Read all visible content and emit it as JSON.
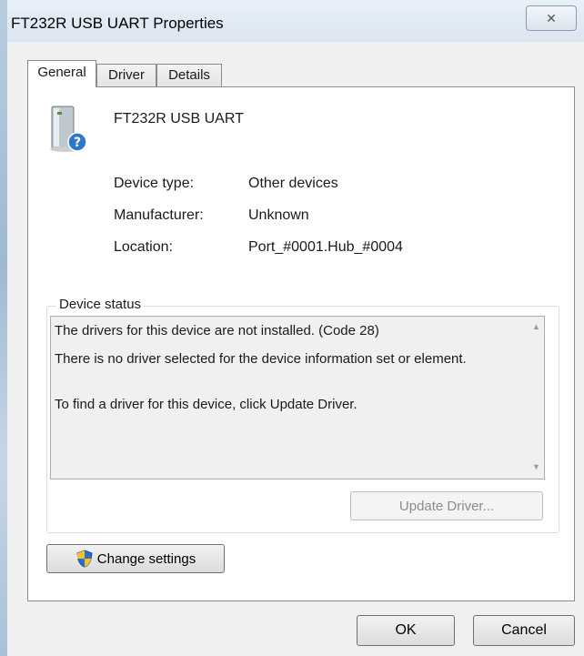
{
  "window": {
    "title": "FT232R USB UART Properties",
    "close_glyph": "✕"
  },
  "tabs": [
    {
      "label": "General",
      "active": true
    },
    {
      "label": "Driver",
      "active": false
    },
    {
      "label": "Details",
      "active": false
    }
  ],
  "device": {
    "name": "FT232R USB UART",
    "icon": "unknown-device-icon",
    "properties": [
      {
        "label": "Device type:",
        "value": "Other devices"
      },
      {
        "label": "Manufacturer:",
        "value": "Unknown"
      },
      {
        "label": "Location:",
        "value": "Port_#0001.Hub_#0004"
      }
    ]
  },
  "status": {
    "group_title": "Device status",
    "lines": [
      "The drivers for this device are not installed. (Code 28)",
      "There is no driver selected for the device information set or element.",
      "To find a driver for this device, click Update Driver."
    ]
  },
  "buttons": {
    "update_driver": "Update Driver...",
    "change_settings": "Change settings",
    "ok": "OK",
    "cancel": "Cancel"
  }
}
